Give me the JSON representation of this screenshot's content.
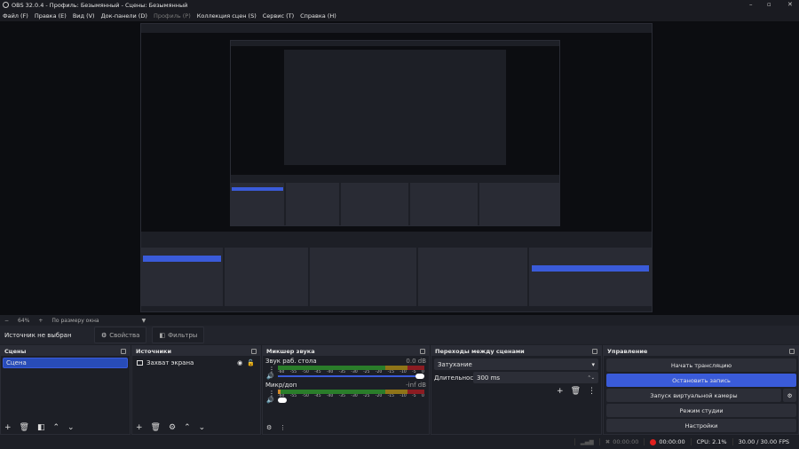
{
  "window": {
    "title": "OBS 32.0.4 - Профиль: Безымянный - Сцены: Безымянный"
  },
  "menu": [
    "Файл (F)",
    "Правка (E)",
    "Вид (V)",
    "Док-панели (D)",
    "Профиль (P)",
    "Коллекция сцен (S)",
    "Сервис (T)",
    "Справка (H)"
  ],
  "zoom": {
    "minus": "−",
    "value": "64%",
    "plus": "+",
    "mode": "По размеру окна"
  },
  "source_toolbar": {
    "status": "Источник не выбран",
    "properties": "Свойства",
    "filters": "Фильтры"
  },
  "scenes": {
    "title": "Сцены",
    "items": [
      {
        "label": "Сцена",
        "selected": true
      }
    ]
  },
  "sources": {
    "title": "Источники",
    "items": [
      {
        "label": "Захват экрана",
        "icon": "monitor-icon",
        "visible": true,
        "locked": false
      }
    ]
  },
  "mixer": {
    "title": "Микшер звука",
    "ticks": [
      "-60",
      "-55",
      "-50",
      "-45",
      "-40",
      "-35",
      "-30",
      "-25",
      "-20",
      "-15",
      "-10",
      "-5",
      "0"
    ],
    "channels": [
      {
        "name": "Звук раб. стола",
        "db": "0.0 dB",
        "level": 0,
        "volume": 1.0
      },
      {
        "name": "Микр/доп",
        "db": "-inf dB",
        "level": 0.02,
        "volume": 0.0
      }
    ]
  },
  "transitions": {
    "title": "Переходы между сценами",
    "type": "Затухание",
    "duration_label": "Длительность",
    "duration": "300 ms"
  },
  "controls": {
    "title": "Управление",
    "start_stream": "Начать трансляцию",
    "stop_record": "Остановить запись",
    "virtual_cam": "Запуск виртуальной камеры",
    "studio_mode": "Режим студии",
    "settings": "Настройки"
  },
  "status": {
    "stream_time": "00:00:00",
    "record_time": "00:00:00",
    "cpu": "CPU: 2.1%",
    "fps": "30.00 / 30.00 FPS"
  },
  "colors": {
    "accent": "#3a5bd9",
    "record": "#e0201e",
    "meter_green": "#2a7d2a",
    "meter_yellow": "#8f7418",
    "meter_red": "#8c1c22"
  }
}
